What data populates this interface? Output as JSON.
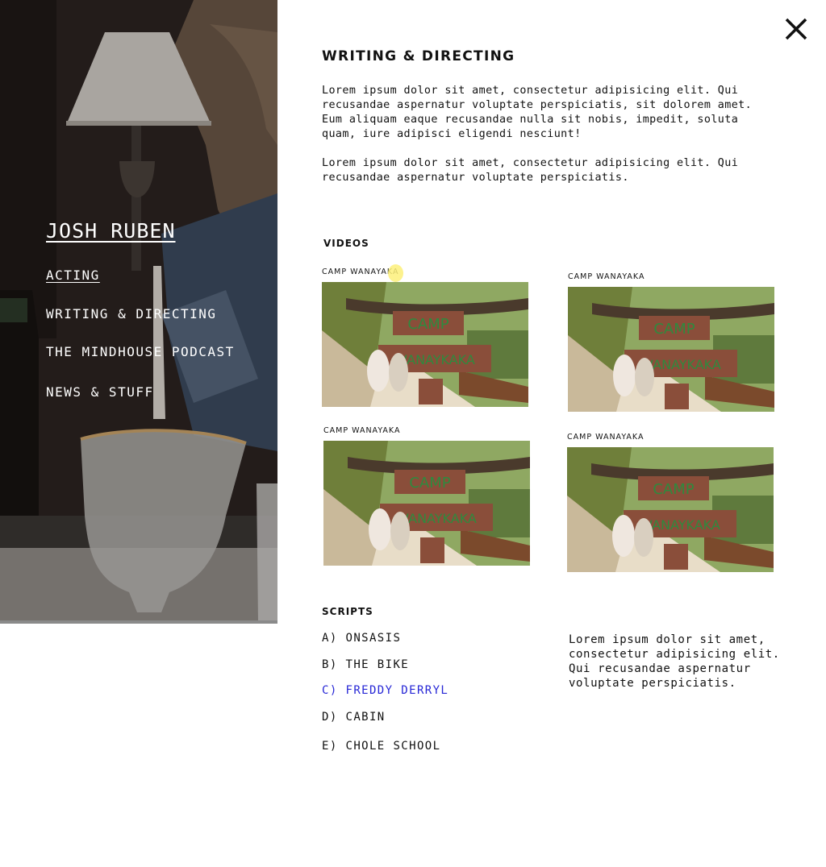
{
  "site": {
    "title": "JOSH RUBEN"
  },
  "nav": {
    "items": [
      {
        "label": "ACTING",
        "active": true
      },
      {
        "label": "WRITING & DIRECTING",
        "active": false
      },
      {
        "label": "THE MINDHOUSE PODCAST",
        "active": false
      },
      {
        "label": "NEWS & STUFF",
        "active": false
      }
    ]
  },
  "close_icon": "close-icon",
  "page": {
    "title": "WRITING & DIRECTING",
    "intro": [
      "Lorem ipsum dolor sit amet, consectetur adipisicing elit. Qui recusandae aspernatur voluptate perspiciatis, sit dolorem amet. Eum aliquam eaque recusandae nulla sit nobis, impedit, soluta quam, iure adipisci eligendi nesciunt!",
      "Lorem ipsum dolor sit amet, consectetur adipisicing elit. Qui recusandae aspernatur voluptate perspiciatis."
    ]
  },
  "videos": {
    "label": "VIDEOS",
    "items": [
      {
        "caption": "CAMP WANAYAKA",
        "sign_top": "CAMP",
        "sign_bottom": "WANAYKAKA"
      },
      {
        "caption": "CAMP WANAYAKA",
        "sign_top": "CAMP",
        "sign_bottom": "WANAYKAKA"
      },
      {
        "caption": "CAMP WANAYAKA",
        "sign_top": "CAMP",
        "sign_bottom": "WANAYKAKA"
      },
      {
        "caption": "CAMP WANAYAKA",
        "sign_top": "CAMP",
        "sign_bottom": "WANAYKAKA"
      }
    ]
  },
  "scripts": {
    "label": "SCRIPTS",
    "items": [
      {
        "label": "A) ONSASIS",
        "active": false
      },
      {
        "label": "B) THE BIKE",
        "active": false
      },
      {
        "label": "C) FREDDY DERRYL",
        "active": true
      },
      {
        "label": "D) CABIN",
        "active": false
      },
      {
        "label": "E) CHOLE SCHOOL",
        "active": false
      }
    ],
    "note": "Lorem ipsum dolor sit amet, consectetur adipisicing elit. Qui recusandae aspernatur voluptate perspiciatis."
  },
  "colors": {
    "active_link": "#2727d6",
    "hero_overlay": "#2a221f",
    "cursor_highlight": "#fdf07a"
  }
}
